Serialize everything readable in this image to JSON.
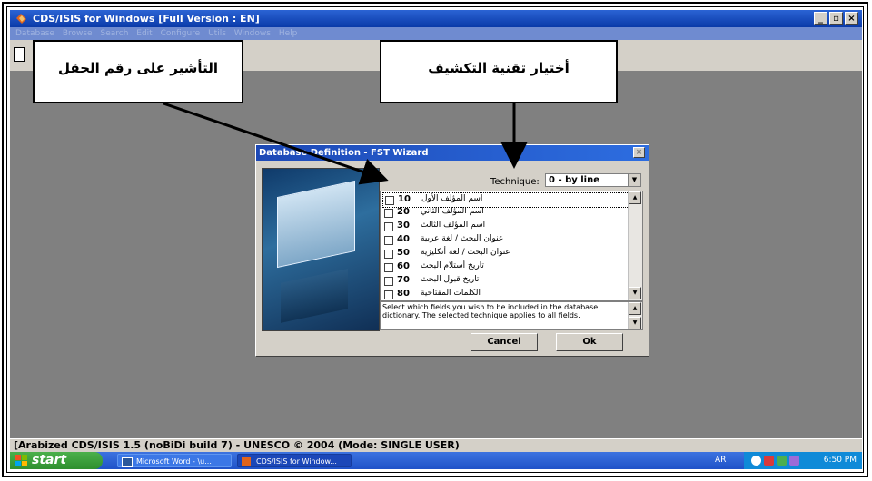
{
  "window": {
    "title": "CDS/ISIS for Windows [Full Version : EN]",
    "minimize": "_",
    "restore": "▫",
    "close": "×"
  },
  "menu": [
    "Database",
    "Browse",
    "Search",
    "Edit",
    "Configure",
    "Utils",
    "Windows",
    "Help"
  ],
  "callouts": {
    "field_pointer": "التأشير على رقم الحقل",
    "technique_choice": "أختيار تقنية التكشيف"
  },
  "dialog": {
    "title": "Database Definition - FST Wizard",
    "technique_label": "Technique:",
    "technique_value": "0 - by line",
    "fields": [
      {
        "tag": "10",
        "name": "اسم المؤلف الأول"
      },
      {
        "tag": "20",
        "name": "اسم المؤلف الثاني"
      },
      {
        "tag": "30",
        "name": "اسم المؤلف الثالث"
      },
      {
        "tag": "40",
        "name": "عنوان البحث / لغة عربية"
      },
      {
        "tag": "50",
        "name": "عنوان البحث / لغة أنكليزية"
      },
      {
        "tag": "60",
        "name": "تاريخ أستلام البحث"
      },
      {
        "tag": "70",
        "name": "تاريخ قبول البحث"
      },
      {
        "tag": "80",
        "name": "الكلمات المفتاحية"
      }
    ],
    "help_text": "Select which fields you wish to be included in the database dictionary. The selected technique applies to all fields.",
    "cancel_label": "Cancel",
    "ok_label": "Ok"
  },
  "status_bar": "[Arabized CDS/ISIS 1.5 (noBiDi build 7) - UNESCO © 2004 (Mode: SINGLE USER)",
  "taskbar": {
    "start_label": "start",
    "tasks": [
      "Microsoft Word - \\u...",
      "CDS/ISIS for Window..."
    ],
    "language": "AR",
    "clock": "6:50 PM"
  },
  "colors": {
    "titlebar": "#0a3aa8",
    "desktop": "#808080",
    "dialog_face": "#d4d0c8",
    "taskbar": "#245edb",
    "start_button": "#3c9a3c"
  }
}
